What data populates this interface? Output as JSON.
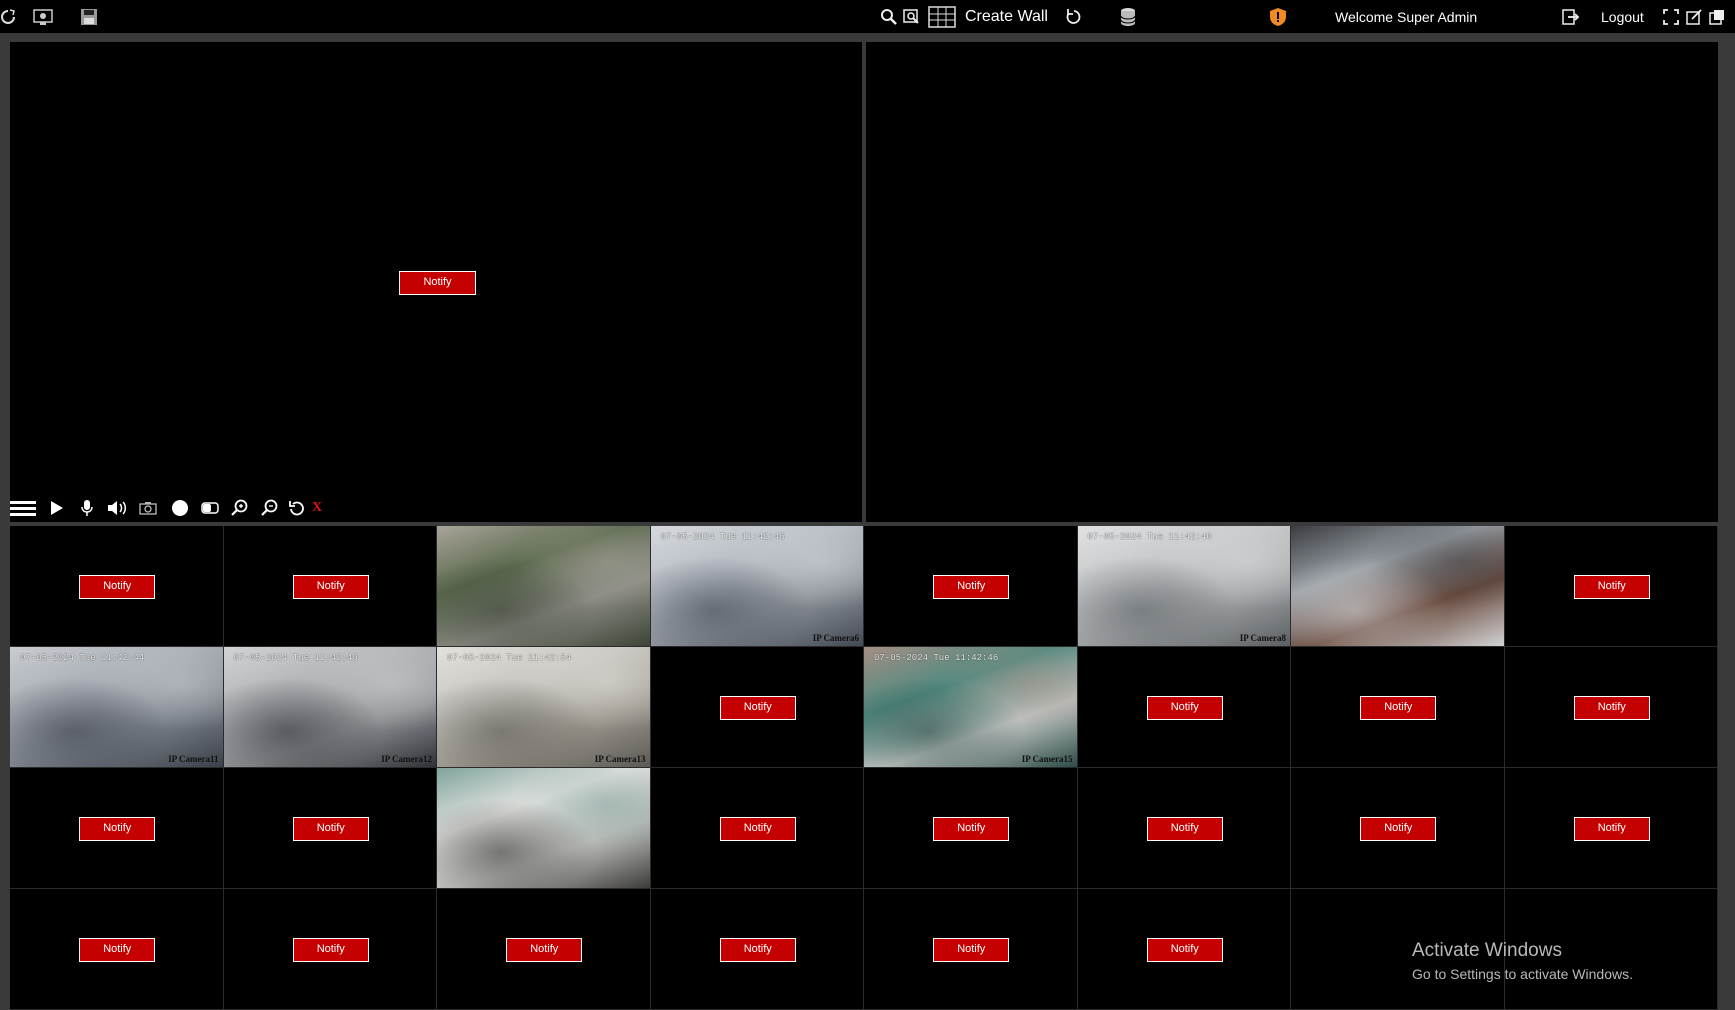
{
  "topbar": {
    "create_wall_label": "Create Wall",
    "welcome_text": "Welcome Super Admin",
    "logout_label": "Logout",
    "icons": [
      "refresh-icon",
      "camera-settings-icon",
      "save-icon",
      "search-icon",
      "search-settings-icon",
      "grid-layout-icon",
      "rotate-icon",
      "database-icon",
      "shield-alert-icon",
      "logout-icon",
      "fullscreen-icon",
      "popout-icon",
      "new-window-icon"
    ]
  },
  "main": {
    "left_pane": {
      "notify_label": "Notify"
    },
    "right_pane": {}
  },
  "player_controls": {
    "close_label": "X",
    "icons": [
      "menu-icon",
      "play-icon",
      "microphone-icon",
      "volume-icon",
      "snapshot-icon",
      "record-icon",
      "toggle-icon",
      "zoom-in-icon",
      "zoom-out-icon",
      "reset-icon",
      "close-icon"
    ]
  },
  "grid": {
    "cells": [
      {
        "type": "notify",
        "label": "Notify"
      },
      {
        "type": "notify",
        "label": "Notify"
      },
      {
        "type": "camera",
        "timestamp": "",
        "name": "",
        "palette": [
          "#5b6a4e",
          "#8a8b84",
          "#3d4436",
          "#a9a49a"
        ]
      },
      {
        "type": "camera",
        "timestamp": "07-05-2024 Tue 11:42:46",
        "name": "IP Camera6",
        "palette": [
          "#b7bcc4",
          "#8b9097",
          "#434a55",
          "#d6dade"
        ]
      },
      {
        "type": "notify",
        "label": "Notify"
      },
      {
        "type": "camera",
        "timestamp": "07-05-2024 Tue 11:42:40",
        "name": "IP Camera8",
        "palette": [
          "#c4c7c9",
          "#9da0a2",
          "#5b6064",
          "#e0e1e2"
        ]
      },
      {
        "type": "camera",
        "timestamp": "",
        "name": "",
        "palette": [
          "#9aa0a6",
          "#6b4b3e",
          "#d1d2d4",
          "#3a3d42"
        ]
      },
      {
        "type": "notify",
        "label": "Notify"
      },
      {
        "type": "camera",
        "timestamp": "07-05-2024 Tue 11:42:44",
        "name": "IP Camera11",
        "palette": [
          "#a8adb5",
          "#7a8089",
          "#3b4049",
          "#c9ccd1"
        ]
      },
      {
        "type": "camera",
        "timestamp": "07-05-2024 Tue 11:42:49",
        "name": "IP Camera12",
        "palette": [
          "#b0b3b6",
          "#8c8f92",
          "#2f3236",
          "#d2d3d4"
        ]
      },
      {
        "type": "camera",
        "timestamp": "07-05-2024 Tue 11:42:54",
        "name": "IP Camera13",
        "palette": [
          "#c8c6c0",
          "#9b978e",
          "#5d5a55",
          "#e3e1dc"
        ]
      },
      {
        "type": "notify",
        "label": "Notify"
      },
      {
        "type": "camera",
        "timestamp": "07-05-2024 Tue 11:42:46",
        "name": "IP Camera15",
        "palette": [
          "#4f8a80",
          "#c2c6c4",
          "#2c4b47",
          "#a48e84"
        ]
      },
      {
        "type": "notify",
        "label": "Notify"
      },
      {
        "type": "notify",
        "label": "Notify"
      },
      {
        "type": "notify",
        "label": "Notify"
      },
      {
        "type": "notify",
        "label": "Notify"
      },
      {
        "type": "notify",
        "label": "Notify"
      },
      {
        "type": "camera",
        "timestamp": "",
        "name": "",
        "palette": [
          "#e4e4e2",
          "#bfbfbc",
          "#3d3c3a",
          "#7fa39c"
        ]
      },
      {
        "type": "notify",
        "label": "Notify"
      },
      {
        "type": "notify",
        "label": "Notify"
      },
      {
        "type": "notify",
        "label": "Notify"
      },
      {
        "type": "notify",
        "label": "Notify"
      },
      {
        "type": "notify",
        "label": "Notify"
      },
      {
        "type": "notify",
        "label": "Notify"
      },
      {
        "type": "notify",
        "label": "Notify"
      },
      {
        "type": "notify",
        "label": "Notify"
      },
      {
        "type": "notify",
        "label": "Notify"
      },
      {
        "type": "notify",
        "label": "Notify"
      },
      {
        "type": "notify",
        "label": "Notify"
      },
      {
        "type": "empty"
      },
      {
        "type": "empty"
      }
    ]
  },
  "watermark": {
    "line1": "Activate Windows",
    "line2": "Go to Settings to activate Windows."
  },
  "colors": {
    "notify_bg": "#c40000",
    "shield": "#f08a24",
    "close_x": "#e01010",
    "background": "#000000",
    "frame": "#3a3a3a"
  }
}
